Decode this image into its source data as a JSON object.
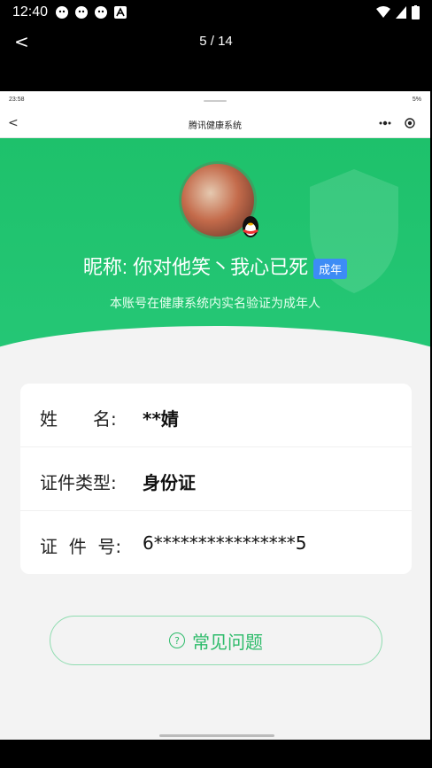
{
  "status_bar": {
    "time": "12:40"
  },
  "viewer": {
    "back_label": "<",
    "counter": "5 / 14"
  },
  "inner_status": {
    "time": "23:58",
    "right": "5%"
  },
  "navbar": {
    "back_label": "<",
    "title": "腾讯健康系统"
  },
  "profile": {
    "nickname": "昵称: 你对他笑丶我心已死",
    "badge": "成年",
    "subtitle": "本账号在健康系统内实名验证为成年人"
  },
  "info": {
    "rows": [
      {
        "label": "姓　　名:",
        "value": "**婧"
      },
      {
        "label": "证件类型:",
        "value": "身份证"
      },
      {
        "label": "证  件  号:",
        "value": "6****************5"
      }
    ]
  },
  "faq": {
    "label": "常见问题",
    "icon_text": "?"
  },
  "colors": {
    "brand_green": "#1ec16b",
    "badge_blue": "#3d8cf5"
  }
}
